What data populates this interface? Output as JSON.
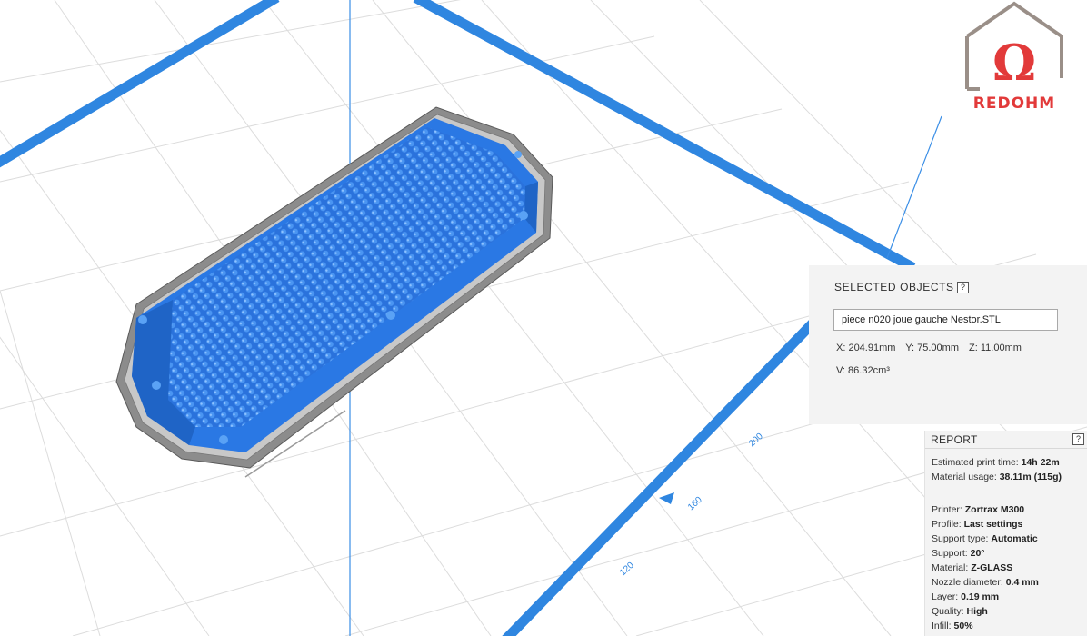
{
  "logo": {
    "text": "REDOHM",
    "symbol": "Ω"
  },
  "axis_ticks": [
    "120",
    "160",
    "200"
  ],
  "selected_objects": {
    "title": "SELECTED OBJECTS",
    "help": "?",
    "filename": "piece n020 joue gauche Nestor.STL",
    "x": "X: 204.91mm",
    "y": "Y: 75.00mm",
    "z": "Z: 11.00mm",
    "volume": "V: 86.32cm³"
  },
  "report": {
    "title": "REPORT",
    "help": "?",
    "lines": [
      {
        "label": "Estimated print time: ",
        "value": "14h 22m"
      },
      {
        "label": "Material usage: ",
        "value": "38.11m (115g)"
      },
      {
        "label": "Printer: ",
        "value": "Zortrax M300"
      },
      {
        "label": "Profile: ",
        "value": "Last settings"
      },
      {
        "label": "Support type: ",
        "value": "Automatic"
      },
      {
        "label": "Support: ",
        "value": "20°"
      },
      {
        "label": "Material: ",
        "value": "Z-GLASS"
      },
      {
        "label": "Nozzle diameter: ",
        "value": "0.4 mm"
      },
      {
        "label": "Layer: ",
        "value": "0.19 mm"
      },
      {
        "label": "Quality: ",
        "value": "High"
      },
      {
        "label": "Infill: ",
        "value": "50%"
      }
    ]
  },
  "colors": {
    "accent": "#2f86e0",
    "model": "#2a78e4",
    "grid": "#d9d9d9"
  }
}
